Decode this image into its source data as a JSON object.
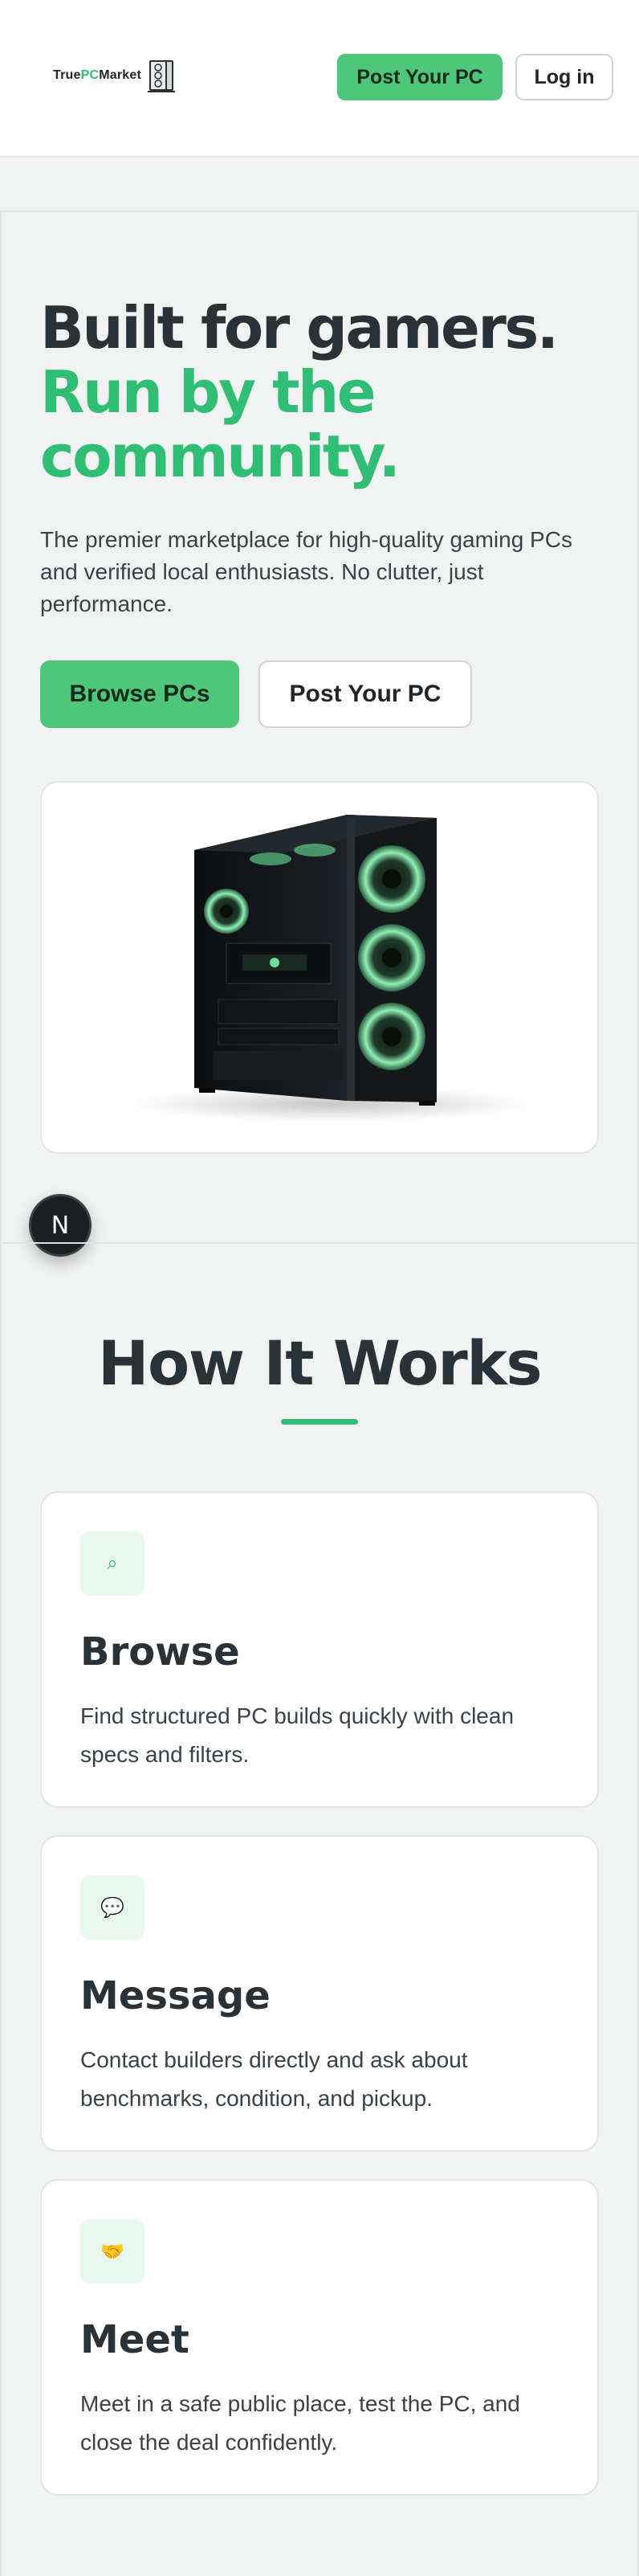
{
  "brand": {
    "logo_prefix": "True",
    "logo_pc": "PC",
    "logo_suffix": "Market",
    "accent": "#2fbf74",
    "button_green": "#4fc77a"
  },
  "header": {
    "post_label": "Post Your PC",
    "login_label": "Log in"
  },
  "hero": {
    "title_line1": "Built for gamers.",
    "title_line2": "Run by the community.",
    "subtitle": "The premier marketplace for high-quality gaming PCs and verified local enthusiasts. No clutter, just performance.",
    "browse_label": "Browse PCs",
    "post_label": "Post Your PC",
    "image_icon": "gaming-pc-tower"
  },
  "floating_badge": "N",
  "how_it_works": {
    "title": "How It Works",
    "steps": [
      {
        "icon": "search-icon",
        "glyph": "⌕",
        "title": "Browse",
        "text": "Find structured PC builds quickly with clean specs and filters."
      },
      {
        "icon": "speech-bubble-icon",
        "glyph": "💬",
        "title": "Message",
        "text": "Contact builders directly and ask about benchmarks, condition, and pickup."
      },
      {
        "icon": "handshake-icon",
        "glyph": "🤝",
        "title": "Meet",
        "text": "Meet in a safe public place, test the PC, and close the deal confidently."
      }
    ]
  }
}
